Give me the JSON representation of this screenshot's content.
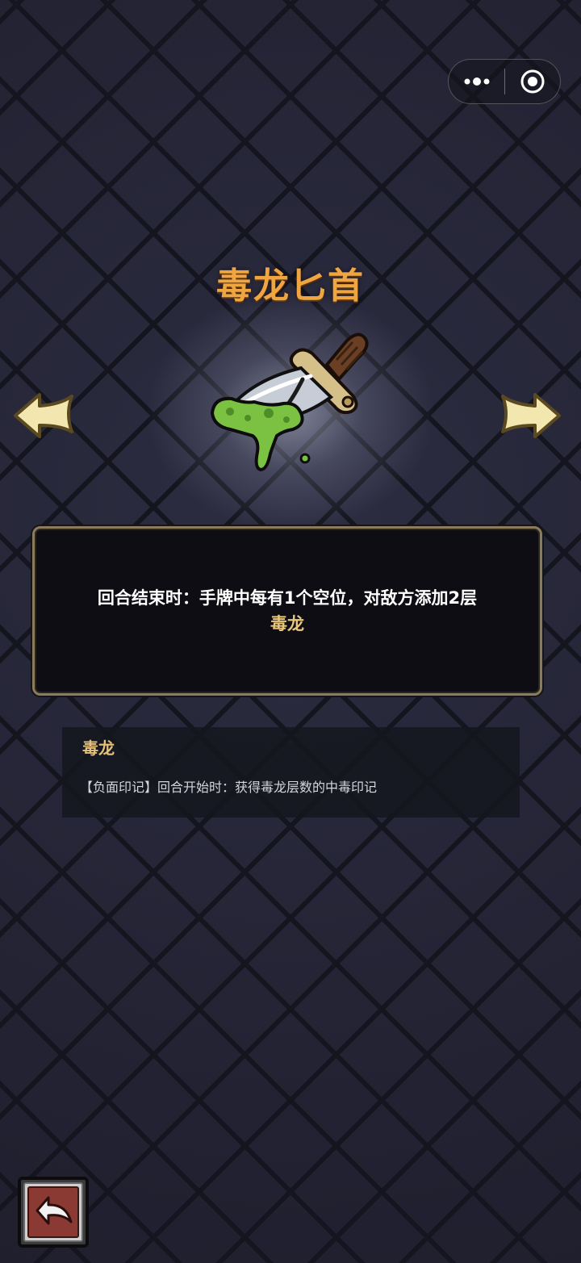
{
  "capsule": {
    "more_icon": "ellipsis-icon",
    "close_icon": "target-circle-icon"
  },
  "item": {
    "name": "毒龙匕首",
    "icon": "poison-dagger-icon",
    "description_line1": "回合结束时：手牌中每有1个空位，对敌方添加2层",
    "description_keyword": "毒龙"
  },
  "keyword_info": {
    "title": "毒龙",
    "text": "【负面印记】回合开始时：获得毒龙层数的中毒印记"
  },
  "navigation": {
    "prev_icon": "arrow-left-icon",
    "next_icon": "arrow-right-icon",
    "back_icon": "return-arrow-icon"
  },
  "colors": {
    "title": "#f0a640",
    "keyword": "#e9c77c",
    "poison_green": "#7cc242"
  }
}
